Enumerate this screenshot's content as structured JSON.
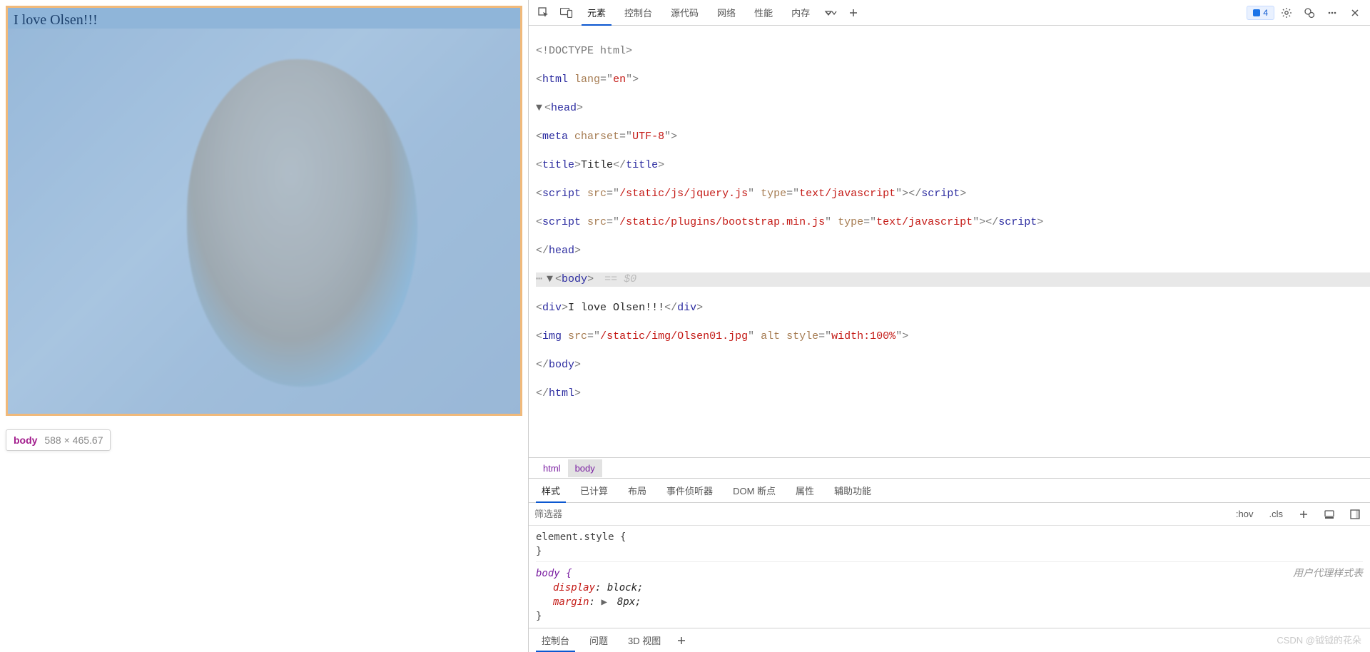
{
  "preview": {
    "text": "I love Olsen!!!",
    "tooltip_name": "body",
    "tooltip_dims": "588 × 465.67"
  },
  "tabs": {
    "elements": "元素",
    "console": "控制台",
    "sources": "源代码",
    "network": "网络",
    "performance": "性能",
    "memory": "内存"
  },
  "issues_count": "4",
  "dom": {
    "l1": "<!DOCTYPE html>",
    "l2a": "<",
    "l2b": "html",
    "l2c": " lang",
    "l2d": "=\"",
    "l2e": "en",
    "l2f": "\">",
    "l3a": "<",
    "l3b": "head",
    "l3c": ">",
    "l4a": "<",
    "l4b": "meta",
    "l4c": " charset",
    "l4d": "=\"",
    "l4e": "UTF-8",
    "l4f": "\">",
    "l5a": "<",
    "l5b": "title",
    "l5c": ">",
    "l5d": "Title",
    "l5e": "</",
    "l5f": "title",
    "l5g": ">",
    "l6a": "<",
    "l6b": "script",
    "l6c": " src",
    "l6d": "=\"",
    "l6e": "/static/js/jquery.js",
    "l6f": "\" ",
    "l6g": "type",
    "l6h": "=\"",
    "l6i": "text/javascript",
    "l6j": "\">",
    "l6k": "</",
    "l6l": "script",
    "l6m": ">",
    "l7a": "<",
    "l7b": "script",
    "l7c": " src",
    "l7d": "=\"",
    "l7e": "/static/plugins/bootstrap.min.js",
    "l7f": "\" ",
    "l7g": "type",
    "l7h": "=\"",
    "l7i": "text/javascript",
    "l7j": "\">",
    "l7k": "</",
    "l7l": "script",
    "l7m": ">",
    "l8a": "</",
    "l8b": "head",
    "l8c": ">",
    "l9a": "<",
    "l9b": "body",
    "l9c": ">",
    "l9d": " == $0",
    "l10a": "<",
    "l10b": "div",
    "l10c": ">",
    "l10d": "I love Olsen!!!",
    "l10e": "</",
    "l10f": "div",
    "l10g": ">",
    "l11a": "<",
    "l11b": "img",
    "l11c": " src",
    "l11d": "=\"",
    "l11e": "/static/img/Olsen01.jpg",
    "l11f": "\" ",
    "l11g": "alt",
    "l11h": " style",
    "l11i": "=\"",
    "l11j": "width:100%",
    "l11k": "\">",
    "l12a": "</",
    "l12b": "body",
    "l12c": ">",
    "l13a": "</",
    "l13b": "html",
    "l13c": ">"
  },
  "crumbs": {
    "c1": "html",
    "c2": "body"
  },
  "subtabs": {
    "styles": "样式",
    "computed": "已计算",
    "layout": "布局",
    "listeners": "事件侦听器",
    "dom": "DOM 断点",
    "props": "属性",
    "a11y": "辅助功能"
  },
  "filter": {
    "placeholder": "筛选器",
    "hov": ":hov",
    "cls": ".cls"
  },
  "styles": {
    "elstyle": "element.style {",
    "close": "}",
    "body": "body {",
    "src": "用户代理样式表",
    "p1n": "display",
    "p1v": ": block;",
    "p2n": "margin",
    "p2v": " 8px;"
  },
  "console_tabs": {
    "console": "控制台",
    "issues": "问题",
    "threed": "3D 视图"
  },
  "watermark": "CSDN @钺钺的花朵"
}
